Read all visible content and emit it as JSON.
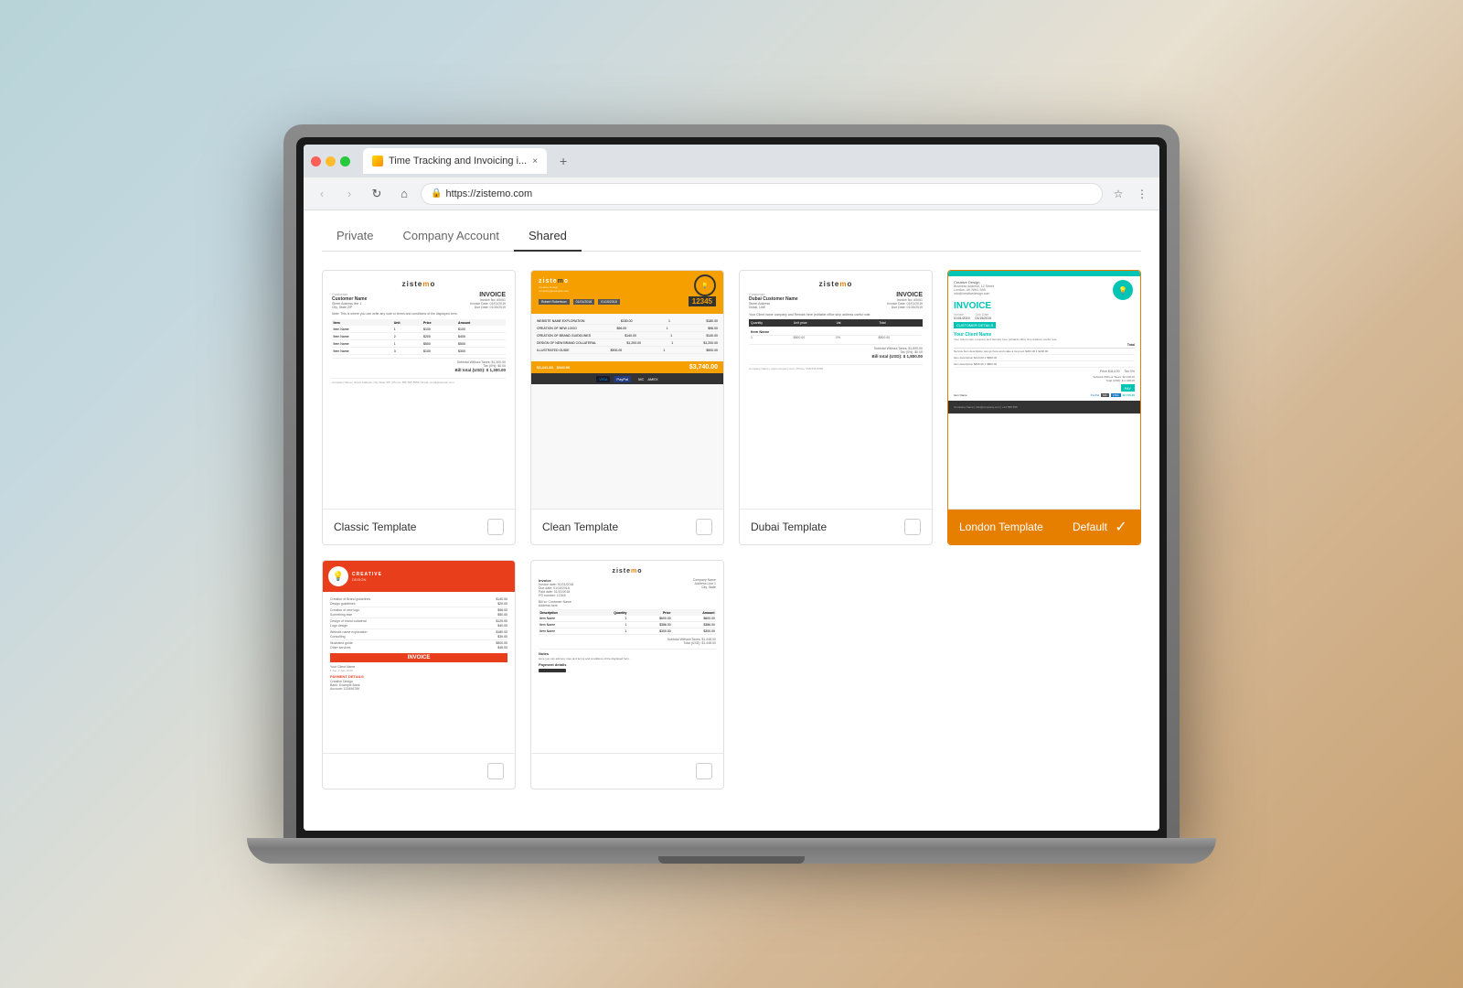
{
  "browser": {
    "tab_title": "Time Tracking and Invoicing i...",
    "url": "https://zistemo.com",
    "nav": {
      "back": "‹",
      "forward": "›",
      "reload": "↻",
      "home": "⌂"
    }
  },
  "page": {
    "tabs": [
      {
        "id": "private",
        "label": "Private",
        "active": false
      },
      {
        "id": "company",
        "label": "Company Account",
        "active": false
      },
      {
        "id": "shared",
        "label": "Shared",
        "active": true
      }
    ]
  },
  "templates": [
    {
      "id": "classic",
      "name": "Classic Template",
      "selected": false
    },
    {
      "id": "clean",
      "name": "Clean Template",
      "selected": false
    },
    {
      "id": "dubai",
      "name": "Dubai Template",
      "selected": false
    },
    {
      "id": "london",
      "name": "London Template",
      "selected": true,
      "default": true,
      "default_label": "Default"
    }
  ],
  "bottom_templates": [
    {
      "id": "orange",
      "name": "",
      "selected": false
    },
    {
      "id": "simple",
      "name": "",
      "selected": false
    }
  ],
  "logo": {
    "text": "zistemo",
    "accent": "m"
  },
  "colors": {
    "orange": "#e67e00",
    "yellow": "#f5a000",
    "teal": "#00c4b4",
    "dark": "#333333",
    "red": "#e83e1c"
  }
}
